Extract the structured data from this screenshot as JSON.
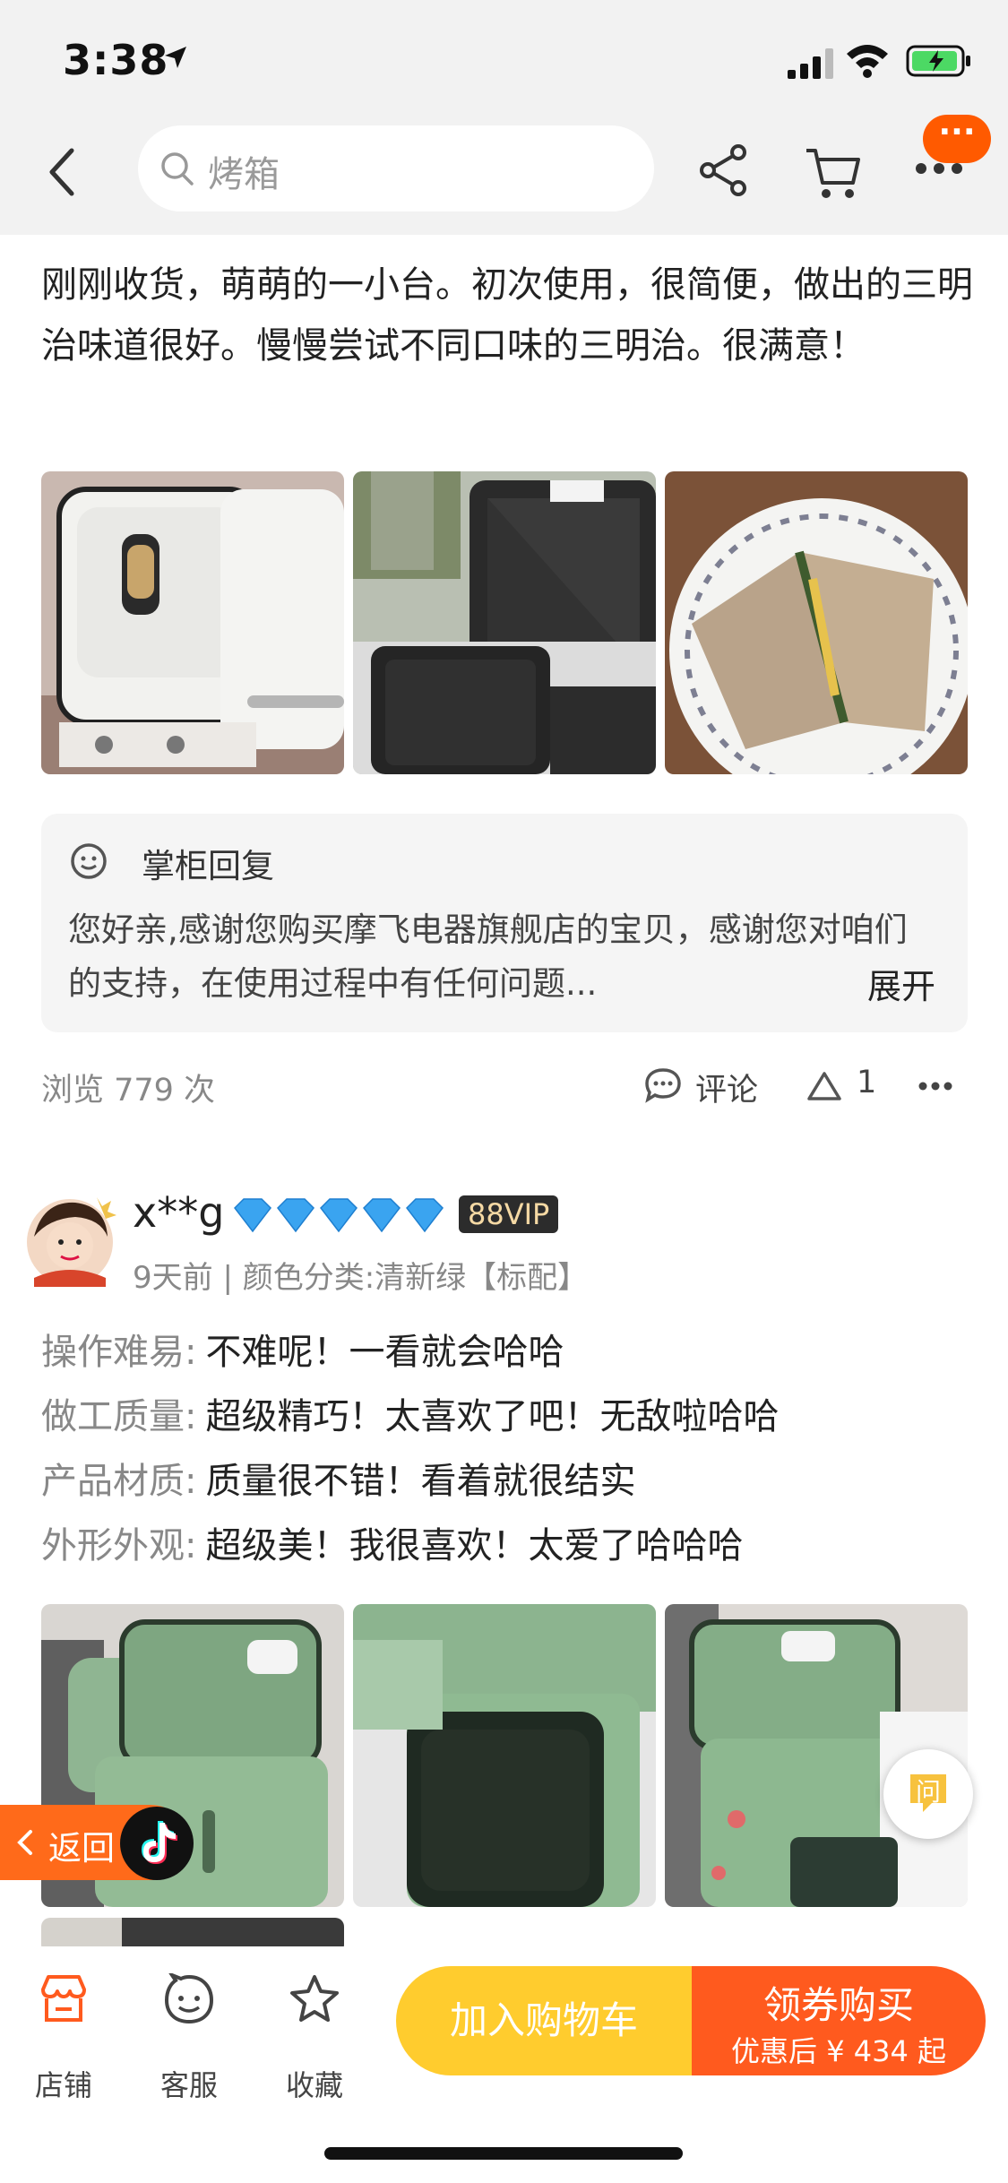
{
  "status": {
    "time": "3:38"
  },
  "nav": {
    "search_placeholder": "烤箱",
    "badge": "···"
  },
  "review1": {
    "text": "刚刚收货，萌萌的一小台。初次使用，很简便，做出的三明治味道很好。慢慢尝试不同口味的三明治。很满意！",
    "reply_title": "掌柜回复",
    "reply_text": "您好亲,感谢您购买摩飞电器旗舰店的宝贝，感谢您对咱们的支持，在使用过程中有任何问题...",
    "reply_expand": "展开",
    "views": "浏览 779 次",
    "comment_label": "评论",
    "like_count": "1"
  },
  "review2": {
    "user": "x**g",
    "vip": "88VIP",
    "date_variant": "9天前 | 颜色分类:清新绿【标配】",
    "attrs": [
      {
        "k": "操作难易:",
        "v": "不难呢！一看就会哈哈"
      },
      {
        "k": "做工质量:",
        "v": "超级精巧！太喜欢了吧！无敌啦哈哈"
      },
      {
        "k": "产品材质:",
        "v": "质量很不错！看着就很结实"
      },
      {
        "k": "外形外观:",
        "v": "超级美！我很喜欢！太爱了哈哈哈"
      }
    ]
  },
  "overlay": {
    "return_label": "返回",
    "ask_label": "问"
  },
  "bottom": {
    "shop": "店铺",
    "service": "客服",
    "favorite": "收藏",
    "add_cart": "加入购物车",
    "buy": "领券购买",
    "buy_sub": "优惠后 ¥ 434 起"
  }
}
